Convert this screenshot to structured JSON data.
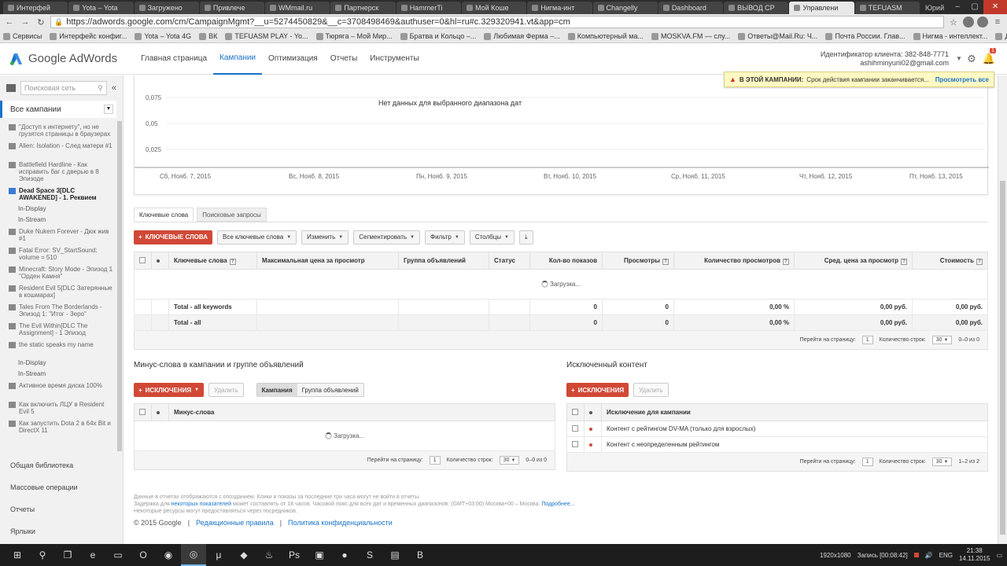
{
  "browser": {
    "tabs": [
      "Интерфей",
      "Yota – Yota",
      "Загружено",
      "Привлече",
      "WMmail.ru",
      "Партнерск",
      "HammerTi",
      "Мой Коше",
      "Нигма-инт",
      "Changelly",
      "Dashboard",
      "ВЫВОД СР",
      "Управлени",
      "TEFUASM"
    ],
    "active_tab": 12,
    "user": "Юрий",
    "url": "https://adwords.google.com/cm/CampaignMgmt?__u=5274450829&__c=3708498469&authuser=0&hl=ru#c.329320941.vt&app=cm",
    "bookmarks": [
      "Сервисы",
      "Интерфейс конфиг...",
      "Yota – Yota 4G",
      "ВК",
      "TEFUASM PLAY - Yo...",
      "Тюрягa – Мой Мир...",
      "Братва и Кольцо –...",
      "Любимая Ферма –...",
      "Компьютерный ма...",
      "MOSKVA.FM — слу...",
      "Ответы@Mail.Ru: Ч...",
      "Почта России. Глав...",
      "Нигма - интеллект...",
      "Другие закладки"
    ]
  },
  "header": {
    "logo": "Google AdWords",
    "nav": [
      "Главная страница",
      "Кампании",
      "Оптимизация",
      "Отчеты",
      "Инструменты"
    ],
    "client_id": "Идентификатор клиента: 382-848-7771",
    "email": "ashihminyurii02@gmail.com",
    "notif_count": "1"
  },
  "alert": {
    "label": "В ЭТОЙ КАМПАНИИ:",
    "message": "Срок действия кампании заканчивается...",
    "link": "Просмотреть все"
  },
  "sidebar": {
    "search_placeholder": "Поисковая сеть",
    "all_campaigns": "Все кампании",
    "items": [
      {
        "label": "\"Доступ к интернету\", но не грузятся страницы в браузерах",
        "bold": false
      },
      {
        "label": "Alien: Isolation - След матери #1",
        "bold": false
      },
      {
        "label": "Battlefield Hardline - Как исправить баг с дверью в 8 Эпизоде",
        "bold": false
      },
      {
        "label": "Dead Space 3[DLC AWAKENED] - 1. Реквием",
        "bold": true,
        "subs": [
          "In-Display",
          "In-Stream"
        ]
      },
      {
        "label": "Duke Nukem Forever - Дюк жив #1",
        "bold": false
      },
      {
        "label": "Fatal Error: SV_StartSound: volume = 510",
        "bold": false
      },
      {
        "label": "Minecraft: Story Mode - Эпизод 1 \"Орден Камня\"",
        "bold": false
      },
      {
        "label": "Resident Evil 5[DLC Затерянные в кошмарах]",
        "bold": false
      },
      {
        "label": "Tales From The Borderlands - Эпизод 1: \"Итог - Зеро\"",
        "bold": false
      },
      {
        "label": "The Evil Within[DLC The Assignment] - 1 Эпизод",
        "bold": false
      },
      {
        "label": "the static speaks my name",
        "bold": false,
        "subs": [
          "In-Display",
          "In-Stream"
        ]
      },
      {
        "label": "Активное время диска 100%",
        "bold": false
      },
      {
        "label": "Как включить ЛЦУ в Resident Evil 5",
        "bold": false
      },
      {
        "label": "Как запустить Dota 2 в 64x Bit и DirectX 11",
        "bold": false
      }
    ],
    "bottom": [
      "Общая библиотека",
      "Массовые операции",
      "Отчеты",
      "Ярлыки"
    ]
  },
  "chart": {
    "no_data": "Нет данных для выбранного диапазона дат",
    "y_ticks": [
      "0,075",
      "0,05",
      "0,025"
    ],
    "x_ticks": [
      "Сб, Нояб. 7, 2015",
      "Вс, Нояб. 8, 2015",
      "Пн, Нояб. 9, 2015",
      "Вт, Нояб. 10, 2015",
      "Ср, Нояб. 11, 2015",
      "Чт, Нояб. 12, 2015",
      "Пт, Нояб. 13, 2015"
    ]
  },
  "keywords": {
    "tabs": [
      "Ключевые слова",
      "Поисковые запросы"
    ],
    "add_btn": "КЛЮЧЕВЫЕ СЛОВА",
    "filters": [
      "Все ключевые слова",
      "Изменить",
      "Сегментировать",
      "Фильтр",
      "Столбцы"
    ],
    "columns": [
      "Ключевые слова",
      "Максимальная цена за просмотр",
      "Группа объявлений",
      "Статус",
      "Кол-во показов",
      "Просмотры",
      "Количество просмотров",
      "Сред. цена за просмотр",
      "Стоимость"
    ],
    "loading": "Загрузка...",
    "totals": [
      {
        "label": "Total - all keywords",
        "impressions": "0",
        "views": "0",
        "view_rate": "0,00 %",
        "avg_cpv": "0,00 руб.",
        "cost": "0,00 руб."
      },
      {
        "label": "Total - all",
        "impressions": "0",
        "views": "0",
        "view_rate": "0,00 %",
        "avg_cpv": "0,00 руб.",
        "cost": "0,00 руб."
      }
    ],
    "pager": {
      "goto": "Перейти на страницу:",
      "page": "1",
      "rows_label": "Количество строк:",
      "rows": "30",
      "range": "0–0 из 0"
    }
  },
  "negatives": {
    "title": "Минус-слова в кампании и группе объявлений",
    "add_btn": "ИСКЛЮЧЕНИЯ",
    "delete": "Удалить",
    "seg": [
      "Кампания",
      "Группа объявлений"
    ],
    "column": "Минус-слова",
    "loading": "Загрузка...",
    "pager": {
      "goto": "Перейти на страницу:",
      "page": "1",
      "rows_label": "Количество строк:",
      "rows": "30",
      "range": "0–0 из 0"
    }
  },
  "excluded": {
    "title": "Исключенный контент",
    "add_btn": "ИСКЛЮЧЕНИЯ",
    "delete": "Удалить",
    "column": "Исключение для кампании",
    "rows": [
      "Контент с рейтингом DV-MA (только для взрослых)",
      "Контент с неопределенным рейтингом"
    ],
    "pager": {
      "goto": "Перейти на страницу:",
      "page": "1",
      "rows_label": "Количество строк:",
      "rows": "30",
      "range": "1–2 из 2"
    }
  },
  "footer": {
    "line1": "Данные в отчетах отображаются с опозданием. Клики и показы за последние три часа могут не войти в отчеты.",
    "line2a": "Задержка для ",
    "line2link": "некоторых показателей",
    "line2b": " может составлять от 18 часов. Часовой пояс для всех дат и временных диапазонов: (GMT+03:00) Москва+00 – Москва. ",
    "more": "Подробнее...",
    "line3": "Некоторые ресурсы могут предоставляться через посредников.",
    "copy": "© 2015 Google",
    "policy1": "Редакционные правила",
    "policy2": "Политика конфиденциальности"
  },
  "taskbar": {
    "resolution": "1920x1080",
    "recording": "Запись [00:08:42]",
    "lang": "ENG",
    "time": "21:38",
    "date": "14.11.2015"
  },
  "colors": {
    "accent": "#1a73c8",
    "red": "#d14836",
    "alert_bg": "#fff9c4"
  }
}
